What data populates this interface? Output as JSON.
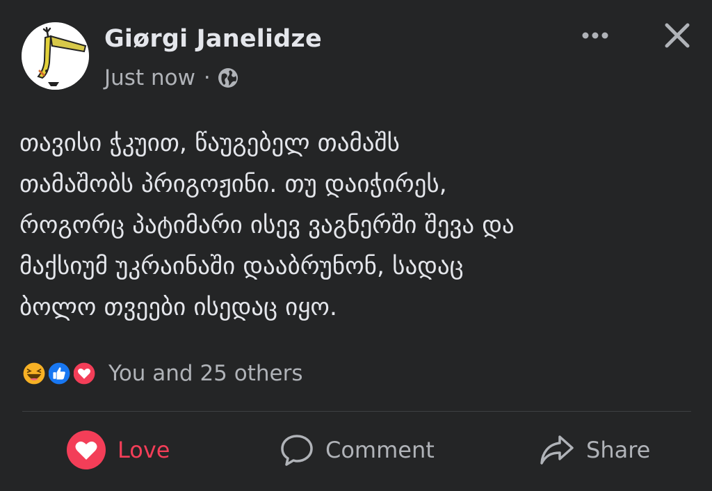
{
  "post": {
    "author": "Giørgi Janelidze",
    "time": "Just now",
    "separator": "·",
    "audience_icon": "globe-icon",
    "text": "თავისი ჭკუით, წაუგებელ თამაშს\nთამაშობს პრიგოჟინი. თუ დაიჭირეს,\nროგორც პატიმარი  ისევ  ვაგნერში შევა და\nმაქსიუმ უკრაინაში დააბრუნონ, სადაც\nბოლო თვეები  ისედაც იყო."
  },
  "reactions": {
    "types": [
      "haha",
      "like",
      "love"
    ],
    "summary": "You and 25 others"
  },
  "actions": {
    "love_label": "Love",
    "comment_label": "Comment",
    "share_label": "Share"
  },
  "colors": {
    "background": "#242526",
    "text_primary": "#e4e6eb",
    "text_secondary": "#b0b3b8",
    "love_red": "#f33e58",
    "like_blue": "#1877f2",
    "haha_yellow": "#f7b125"
  }
}
